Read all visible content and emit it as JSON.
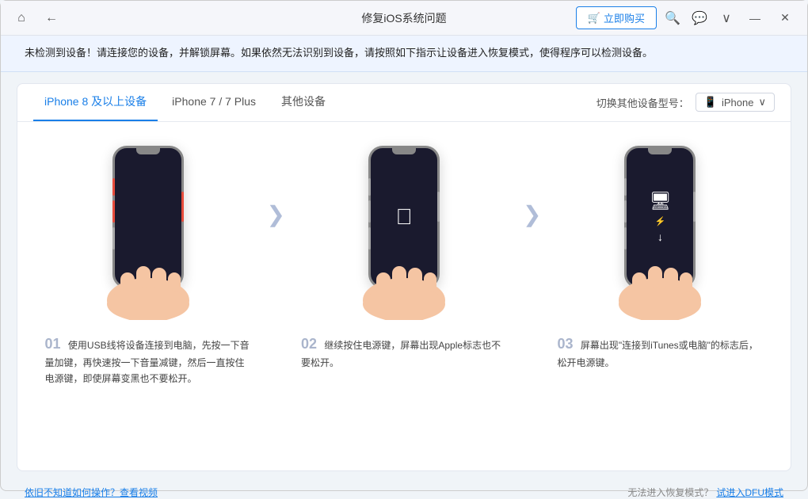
{
  "window": {
    "title": "修复iOS系统问题",
    "buy_label": "立即购买"
  },
  "alert": {
    "text": "未检测到设备！请连接您的设备，并解锁屏幕。如果依然无法识别到设备，请按照如下指示让设备进入恢复模式，使得程序可以检测设备。"
  },
  "tabs": [
    {
      "label": "iPhone 8 及以上设备",
      "active": true
    },
    {
      "label": "iPhone 7 / 7 Plus",
      "active": false
    },
    {
      "label": "其他设备",
      "active": false
    }
  ],
  "device_switch": {
    "label": "切换其他设备型号：",
    "current": "iPhone"
  },
  "steps": [
    {
      "num": "01",
      "description": "使用USB线将设备连接到电脑，先按一下音量加键，再快速按一下音量减键，然后一直按住电源键，即使屏幕变黑也不要松开。"
    },
    {
      "num": "02",
      "description": "继续按住电源键，屏幕出现Apple标志也不要松开。"
    },
    {
      "num": "03",
      "description": "屏幕出现\"连接到iTunes或电脑\"的标志后，松开电源键。"
    }
  ],
  "footer": {
    "help_link": "依旧不知道如何操作？查看视频",
    "recovery_text": "无法进入恢复模式？",
    "recovery_link": "试进入DFU模式"
  },
  "icons": {
    "home": "⌂",
    "back": "←",
    "cart": "🛒",
    "search": "🔍",
    "chat": "💬",
    "chevron_down": "∨",
    "minimize": "—",
    "close": "✕",
    "arrow_right": "❯",
    "phone_icon": "📱"
  }
}
